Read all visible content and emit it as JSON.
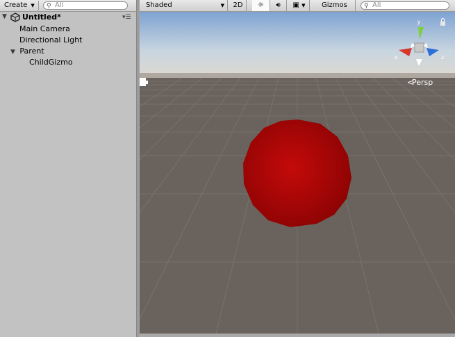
{
  "hierarchy": {
    "create_label": "Create",
    "search_placeholder": "All",
    "scene_name": "Untitled*",
    "items": [
      {
        "label": "Main Camera"
      },
      {
        "label": "Directional Light"
      },
      {
        "label": "Parent"
      },
      {
        "label": "ChildGizmo"
      }
    ]
  },
  "scene_toolbar": {
    "shading_mode": "Shaded",
    "mode_2d": "2D",
    "gizmos_label": "Gizmos",
    "search_placeholder": "All"
  },
  "viewport": {
    "projection_label": "Persp",
    "gizmo_axes": {
      "y": "y",
      "x": "x",
      "z": "z"
    },
    "sphere_color": "#b30505",
    "sky_color": "#8fb4de",
    "ground_color": "#6a635d"
  }
}
